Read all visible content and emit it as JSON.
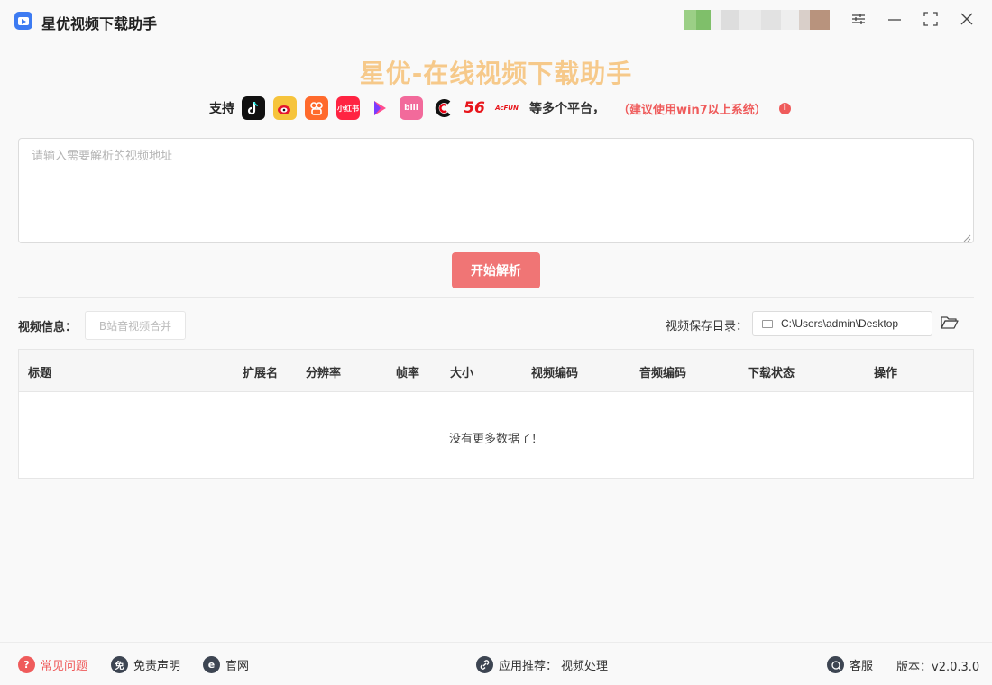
{
  "window": {
    "title": "星优视频下载助手",
    "controls": [
      "settings-icon",
      "minimize-icon",
      "maximize-icon",
      "close-icon"
    ]
  },
  "header": {
    "headline": "星优-在线视频下载助手",
    "support_label": "支持",
    "platforms": [
      {
        "name": "douyin-icon",
        "color": "#111111",
        "glyph": "♪"
      },
      {
        "name": "weibo-icon",
        "color": "#f6c43c",
        "glyph": "◉"
      },
      {
        "name": "kuaishou-icon",
        "color": "#ff6a2c",
        "glyph": "✿"
      },
      {
        "name": "xiaohongshu-icon",
        "color": "#ff2442",
        "glyph": "小红书"
      },
      {
        "name": "video-play-icon",
        "color": "#ffffff",
        "glyph": "▶"
      },
      {
        "name": "bilibili-icon",
        "color": "#f26a9b",
        "glyph": "bili"
      },
      {
        "name": "cctv-icon",
        "color": "#ffffff",
        "glyph": "C"
      },
      {
        "name": "56-icon",
        "color": "#ffffff",
        "glyph": "56"
      },
      {
        "name": "acfun-icon",
        "color": "#ffffff",
        "glyph": "AcFUN"
      }
    ],
    "multi_platform": "等多个平台，",
    "recommend": "（建议使用win7以上系统）"
  },
  "input": {
    "placeholder": "请输入需要解析的视频地址",
    "value": ""
  },
  "parse_button": "开始解析",
  "video_info": {
    "label": "视频信息：",
    "merge_button": "B站音视频合并",
    "save_dir_label": "视频保存目录：",
    "save_dir_value": "C:\\Users\\admin\\Desktop"
  },
  "table": {
    "columns": [
      "标题",
      "扩展名",
      "分辨率",
      "帧率",
      "大小",
      "视频编码",
      "音频编码",
      "下载状态",
      "操作"
    ],
    "rows": [],
    "empty_text": "没有更多数据了！"
  },
  "footer": {
    "faq": "常见问题",
    "disclaimer": "免责声明",
    "website": "官网",
    "app_recommend_label": "应用推荐：",
    "app_recommend_value": "视频处理",
    "support": "客服",
    "version": "版本：v2.0.3.0"
  },
  "colors": {
    "accent": "#f07575",
    "headline": "#f6c98a",
    "warning": "#ef5b5b",
    "logo": "#3d7bf2"
  }
}
